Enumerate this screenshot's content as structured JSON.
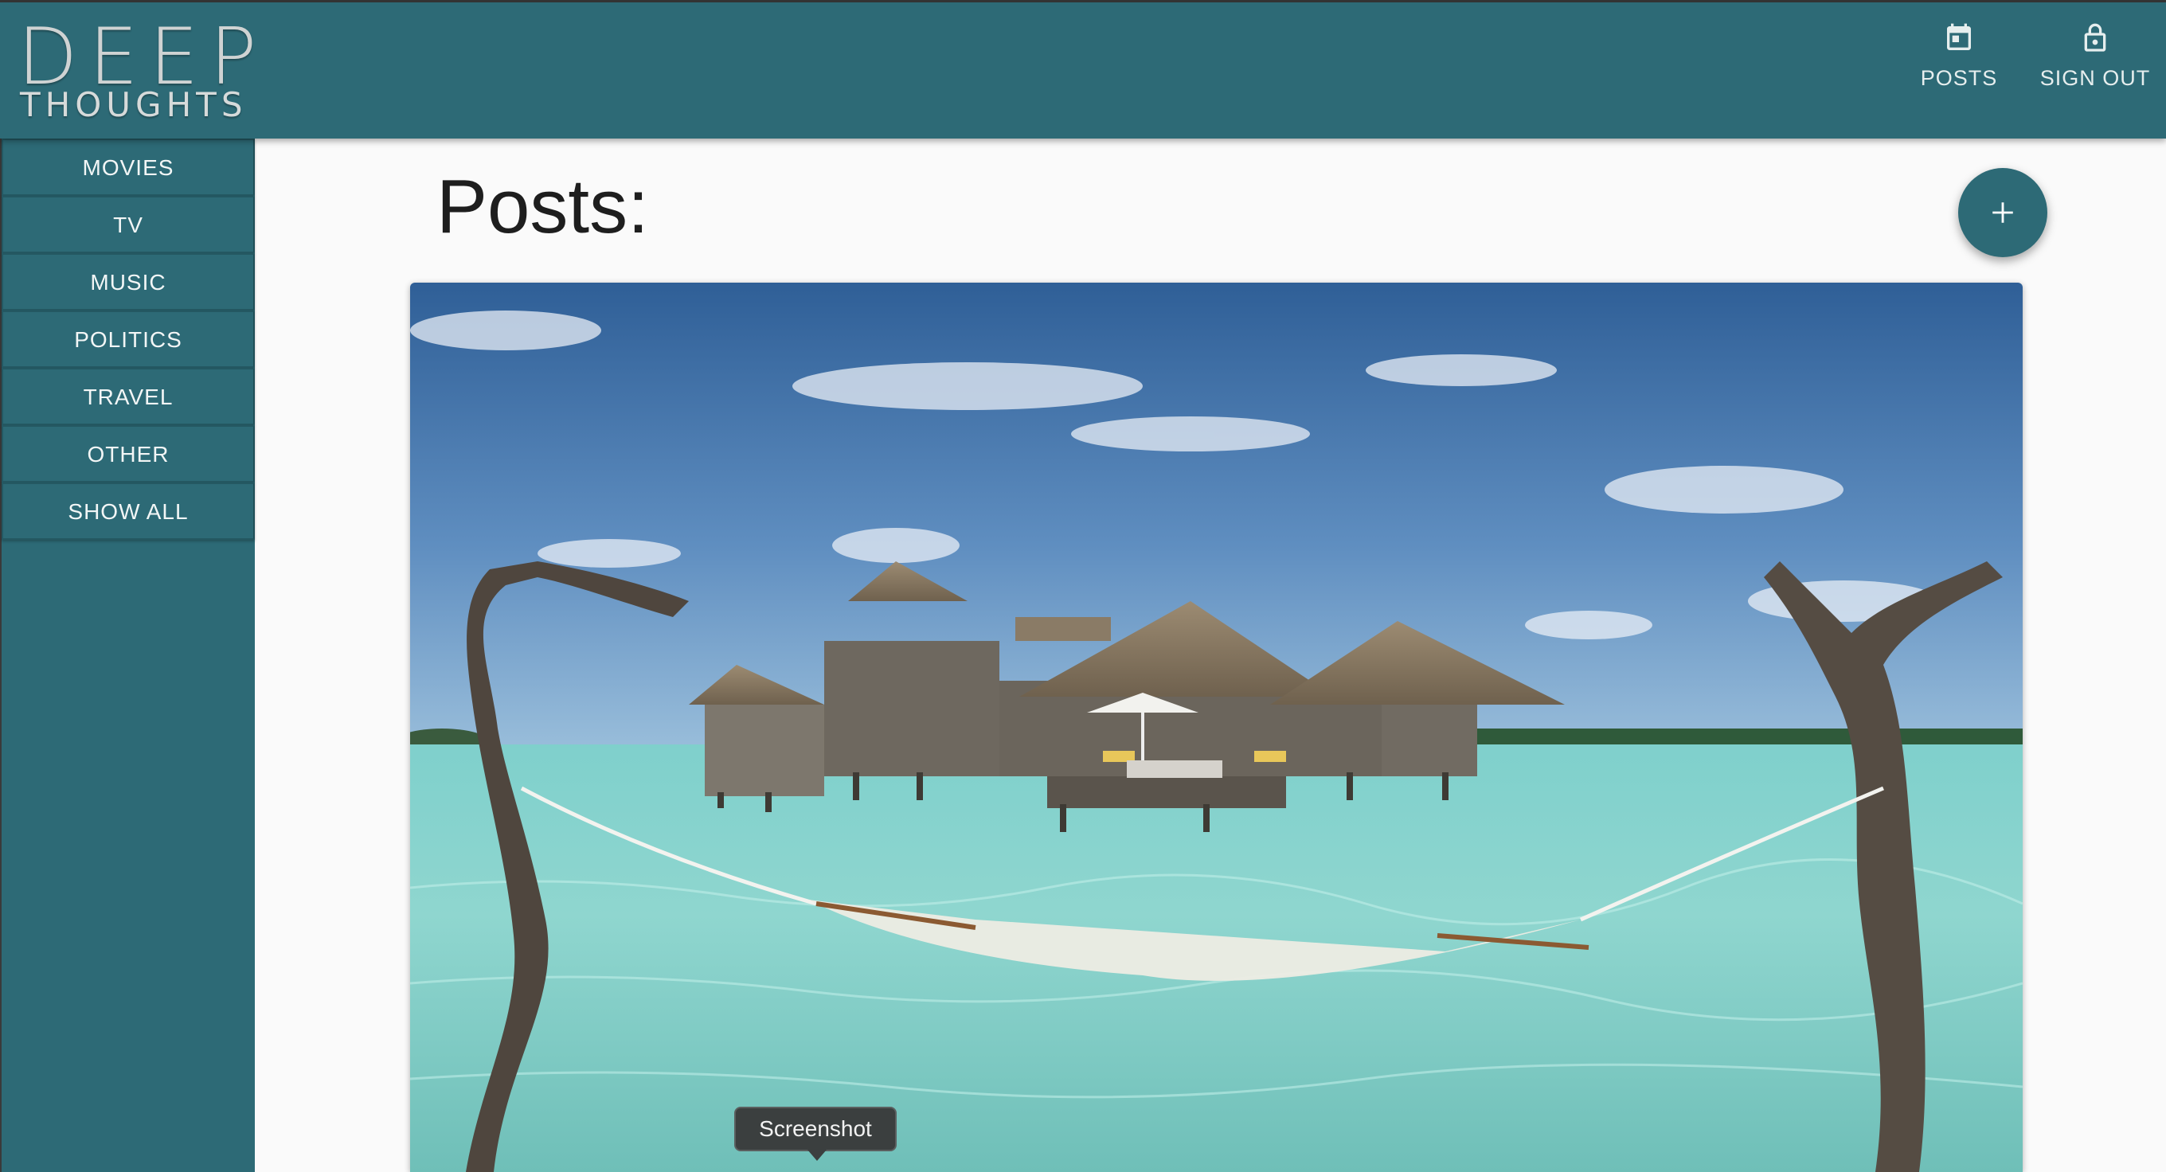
{
  "app": {
    "logo_line1": "DEEP",
    "logo_line2": "THOUGHTS",
    "accent_color": "#2d6a76"
  },
  "header": {
    "posts_label": "POSTS",
    "posts_icon": "calendar-icon",
    "signout_label": "SIGN OUT",
    "signout_icon": "lock-icon"
  },
  "sidebar": {
    "items": [
      {
        "label": "MOVIES"
      },
      {
        "label": "TV"
      },
      {
        "label": "MUSIC"
      },
      {
        "label": "POLITICS"
      },
      {
        "label": "TRAVEL"
      },
      {
        "label": "OTHER"
      },
      {
        "label": "SHOW ALL"
      }
    ]
  },
  "main": {
    "title": "Posts:",
    "add_button_icon": "plus-icon"
  },
  "tooltip": {
    "text": "Screenshot"
  }
}
